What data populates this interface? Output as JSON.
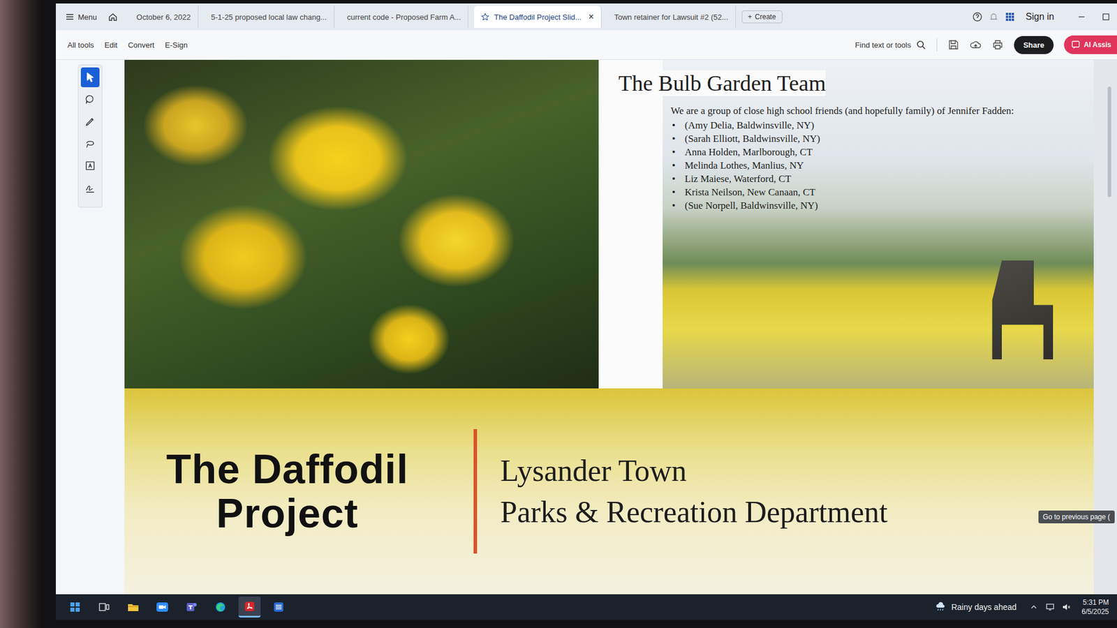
{
  "tab_bar": {
    "menu": "Menu",
    "tabs": [
      {
        "label": "October 6, 2022",
        "selected": false,
        "starred": false,
        "close": ""
      },
      {
        "label": "5-1-25 proposed local law chang...",
        "selected": false,
        "starred": false,
        "close": ""
      },
      {
        "label": "current code - Proposed Farm A...",
        "selected": false,
        "starred": false,
        "close": ""
      },
      {
        "label": "The Daffodil Project Slid...",
        "selected": true,
        "starred": true,
        "close": "×"
      },
      {
        "label": "Town retainer for Lawsuit #2 (52...",
        "selected": false,
        "starred": false,
        "close": ""
      }
    ],
    "create_icon": "+",
    "create": "Create",
    "sign_in": "Sign in"
  },
  "toolbar": {
    "items": [
      "All tools",
      "Edit",
      "Convert",
      "E-Sign"
    ],
    "search": "Find text or tools",
    "share": "Share",
    "ai": "AI Assis"
  },
  "tool_rail": [
    {
      "selected": true
    },
    {
      "selected": false
    },
    {
      "selected": false
    },
    {
      "selected": false
    },
    {
      "selected": false
    },
    {
      "selected": false
    }
  ],
  "slide": {
    "team_title": "The Bulb Garden Team",
    "intro": "We are a group of close high school friends (and hopefully family) of Jennifer Fadden:",
    "members": [
      "(Amy Delia, Baldwinsville, NY)",
      "(Sarah Elliott, Baldwinsville, NY)",
      "Anna Holden, Marlborough, CT",
      "Melinda Lothes, Manlius, NY",
      "Liz Maiese, Waterford, CT",
      "Krista Neilson, New Canaan, CT",
      "(Sue Norpell, Baldwinsville, NY)"
    ],
    "bullet": "•",
    "title": "The Daffodil Project",
    "org_lines": [
      "Lysander Town",
      "Parks & Recreation Department"
    ]
  },
  "tooltip": "Go to previous page (",
  "taskbar": {
    "apps": [
      {
        "selected": false
      },
      {
        "selected": false
      },
      {
        "selected": false
      },
      {
        "selected": false
      },
      {
        "selected": false
      },
      {
        "selected": false
      },
      {
        "selected": true
      },
      {
        "selected": false
      }
    ],
    "weather": "Rainy days ahead",
    "time": "5:31 PM",
    "date": "6/5/2025"
  }
}
